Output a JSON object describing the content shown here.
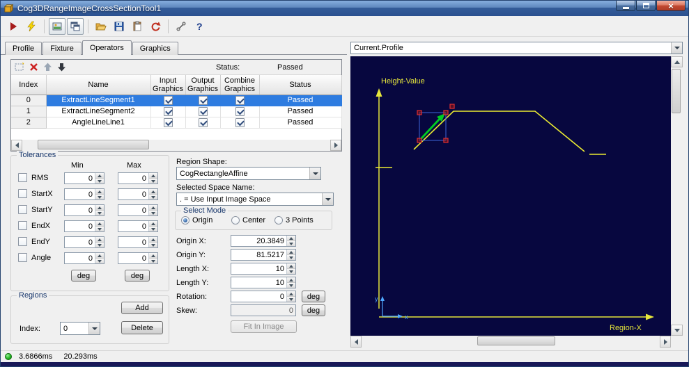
{
  "window": {
    "title": "Cog3DRangeImageCrossSectionTool1"
  },
  "tabs": {
    "items": [
      "Profile",
      "Fixture",
      "Operators",
      "Graphics"
    ],
    "active": "Operators"
  },
  "toolbar_icons": [
    "run",
    "run-electric",
    "image-display-toggle",
    "float-display-toggle",
    "open-file",
    "save-file",
    "paste-results",
    "reset-tool",
    "calibration",
    "help"
  ],
  "grid_toolbar_icons": [
    "new-operator",
    "delete-operator",
    "move-up",
    "move-down"
  ],
  "operators": {
    "status_label": "Status:",
    "status_value": "Passed",
    "grid": {
      "headers": {
        "index": "Index",
        "name": "Name",
        "input": "Input Graphics",
        "output": "Output Graphics",
        "combine": "Combine Graphics",
        "status": "Status"
      },
      "rows": [
        {
          "index": "0",
          "name": "ExtractLineSegment1",
          "input_checked": true,
          "output_checked": true,
          "combine_checked": true,
          "status": "Passed",
          "selected": true
        },
        {
          "index": "1",
          "name": "ExtractLineSegment2",
          "input_checked": true,
          "output_checked": true,
          "combine_checked": true,
          "status": "Passed",
          "selected": false
        },
        {
          "index": "2",
          "name": "AngleLineLine1",
          "input_checked": true,
          "output_checked": true,
          "combine_checked": true,
          "status": "Passed",
          "selected": false
        }
      ]
    }
  },
  "tolerances": {
    "title": "Tolerances",
    "col_min": "Min",
    "col_max": "Max",
    "rows": [
      {
        "label": "RMS",
        "min": "0",
        "max": "0"
      },
      {
        "label": "StartX",
        "min": "0",
        "max": "0"
      },
      {
        "label": "StartY",
        "min": "0",
        "max": "0"
      },
      {
        "label": "EndX",
        "min": "0",
        "max": "0"
      },
      {
        "label": "EndY",
        "min": "0",
        "max": "0"
      },
      {
        "label": "Angle",
        "min": "0",
        "max": "0"
      }
    ],
    "deg_min": "deg",
    "deg_max": "deg"
  },
  "region": {
    "shape_label": "Region Shape:",
    "shape_value": "CogRectangleAffine",
    "space_label": "Selected Space Name:",
    "space_value": ". = Use Input Image Space",
    "mode_title": "Select Mode",
    "modes": [
      "Origin",
      "Center",
      "3 Points"
    ],
    "selected_mode": "Origin",
    "origin_x_label": "Origin X:",
    "origin_x": "20.3849",
    "origin_y_label": "Origin Y:",
    "origin_y": "81.5217",
    "length_x_label": "Length X:",
    "length_x": "10",
    "length_y_label": "Length Y:",
    "length_y": "10",
    "rotation_label": "Rotation:",
    "rotation": "0",
    "rotation_unit": "deg",
    "skew_label": "Skew:",
    "skew": "0",
    "skew_unit": "deg",
    "fit_button": "Fit In Image"
  },
  "regions": {
    "title": "Regions",
    "add_button": "Add",
    "delete_button": "Delete",
    "index_label": "Index:",
    "index_value": "0"
  },
  "display": {
    "selector_value": "Current.Profile",
    "y_axis_label": "Height-Value",
    "x_axis_label": "Region-X",
    "marker_x": "x",
    "marker_y": "y",
    "colors": {
      "background": "#07073F",
      "plot": "#ECEC32",
      "selection_arrow": "#00CC22",
      "handles": "#D42020",
      "marker_axes": "#4FA8FF",
      "selection_highlight": "#2E7CE0"
    }
  },
  "statusbar": {
    "run_time": "3.6866ms",
    "total_time": "20.293ms"
  }
}
